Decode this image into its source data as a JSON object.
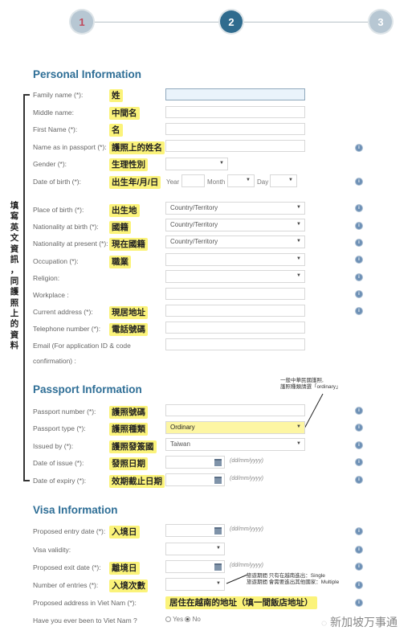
{
  "stepper": {
    "steps": [
      "1",
      "2",
      "3"
    ],
    "current": 2
  },
  "side_note": [
    "填",
    "寫",
    "英",
    "文",
    "資",
    "訊",
    "，",
    "同",
    "護",
    "照",
    "上",
    "的",
    "資",
    "料"
  ],
  "personal": {
    "title": "Personal Information",
    "fields": {
      "family_name": {
        "label": "Family name (*):",
        "hint": "姓"
      },
      "middle_name": {
        "label": "Middle name:",
        "hint": "中間名"
      },
      "first_name": {
        "label": "First Name (*):",
        "hint": "名"
      },
      "name_passport": {
        "label": "Name as in passport (*):",
        "hint": "護照上的姓名"
      },
      "gender": {
        "label": "Gender (*):",
        "hint": "生理性別"
      },
      "dob": {
        "label": "Date of birth (*):",
        "hint": "出生年/月/日",
        "year_label": "Year",
        "month_label": "Month",
        "day_label": "Day"
      },
      "place_of_birth": {
        "label": "Place of birth (*):",
        "hint": "出生地",
        "value": "Country/Territory"
      },
      "nationality_birth": {
        "label": "Nationality at birth (*):",
        "hint": "國籍",
        "value": "Country/Territory"
      },
      "nationality_present": {
        "label": "Nationality at present (*):",
        "hint": "現在國籍",
        "value": "Country/Territory"
      },
      "occupation": {
        "label": "Occupation (*):",
        "hint": "職業"
      },
      "religion": {
        "label": "Religion:"
      },
      "workplace": {
        "label": "Workplace :"
      },
      "current_address": {
        "label": "Current address (*):",
        "hint": "現居地址"
      },
      "telephone": {
        "label": "Telephone number (*):",
        "hint": "電話號碼"
      },
      "email": {
        "label_line1": "Email (For application ID & code",
        "label_line2": "confirmation) :"
      }
    }
  },
  "passport": {
    "title": "Passport Information",
    "annotation_line1": "一般中華民國護照,",
    "annotation_line2": "護照種類請選「ordinary」",
    "fields": {
      "number": {
        "label": "Passport number (*):",
        "hint": "護照號碼"
      },
      "type": {
        "label": "Passport type (*):",
        "hint": "護照種類",
        "value": "Ordinary"
      },
      "issued_by": {
        "label": "Issued by (*):",
        "hint": "護照發簽國",
        "value": "Taiwan"
      },
      "date_issue": {
        "label": "Date of issue (*):",
        "hint": "發照日期",
        "format": "(dd/mm/yyyy)"
      },
      "date_expiry": {
        "label": "Date of expiry (*):",
        "hint": "效期截止日期",
        "format": "(dd/mm/yyyy)"
      }
    }
  },
  "visa": {
    "title": "Visa Information",
    "entries_note_line1": "旅遊期間 只有在越南進出：Single",
    "entries_note_line2": "旅遊期間 會需要進出其他國家：Multiple",
    "fields": {
      "entry_date": {
        "label": "Proposed entry date (*):",
        "hint": "入境日",
        "format": "(dd/mm/yyyy)"
      },
      "validity": {
        "label": "Visa validity:"
      },
      "exit_date": {
        "label": "Proposed exit date (*):",
        "hint": "離境日",
        "format": "(dd/mm/yyyy)"
      },
      "entries": {
        "label": "Number of entries (*):",
        "hint": "入境次數"
      },
      "address_vn": {
        "label": "Proposed address in Viet Nam (*):",
        "hint": "居住在越南的地址（填一間飯店地址）"
      },
      "been_vn": {
        "label": "Have you ever been to Viet Nam ?",
        "options": [
          "Yes",
          "No"
        ],
        "selected": "No"
      }
    }
  },
  "watermark": "新加坡万事通",
  "info_icon": "i"
}
